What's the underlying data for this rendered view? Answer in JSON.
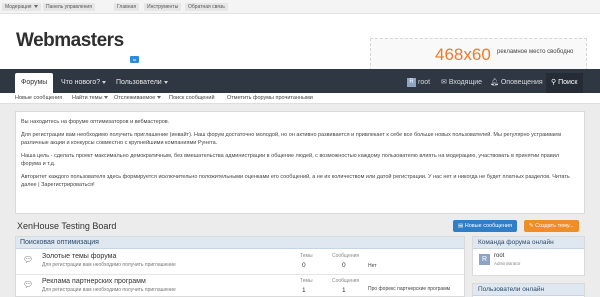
{
  "topbar": {
    "links": [
      {
        "label": "Модерация",
        "dropdown": true
      },
      {
        "label": "Панель управления"
      },
      {
        "label": "Главная"
      },
      {
        "label": "Инструменты"
      },
      {
        "label": "Обратная связь"
      }
    ]
  },
  "header": {
    "logo": "Webmasters",
    "logo_badge": "ru",
    "ad_size": "468x60",
    "ad_text": "рекламное место свободно"
  },
  "nav": {
    "tabs": [
      {
        "label": "Форумы"
      },
      {
        "label": "Что нового?"
      },
      {
        "label": "Пользователи"
      }
    ],
    "user": {
      "avatar_letter": "R",
      "name": "root"
    },
    "inbox": "Входящие",
    "alerts": "Оповещения",
    "search": "Поиск"
  },
  "subnav": {
    "links": [
      "Новые сообщения",
      "Найти темы",
      "Отслеживаемое",
      "Поиск сообщений",
      "Отметить форумы прочитанными"
    ]
  },
  "notice": {
    "p1": "Вы находитесь на форуме оптимизаторов и вебмастеров.",
    "p2": "Для регистрации вам необходимо получить приглашение (инвайт). Наш форум достаточно молодой, но он активно развивается и привлекает к себе все больше новых пользователей. Мы регулярно устраиваем различные акции и конкурсы совместно с крупнейшими компаниями Рунета.",
    "p3": "Наша цель - сделать проект максимально демократичным, без вмешательства администрации в общение людей, с возможностью каждому пользователю влиять на модерацию, участвовать в принятии правил форума и т.д.",
    "p4": "Авторитет каждого пользователя здесь формируется исключительно положительными оценками его сообщений, а не их количеством или датой регистрации. У нас нет и никогда не будет платных разделов. Читать далее | Зарегистрироваться!"
  },
  "board": {
    "title": "XenHouse Testing Board",
    "new_posts_button": "Новые сообщения",
    "create_thread_button": "Создать тему..."
  },
  "forum": {
    "category": "Поисковая оптимизация",
    "rows": [
      {
        "title": "Золотые темы форума",
        "desc": "Для регистрации вам необходимо получить приглашение",
        "threads_label": "Темы",
        "threads": "0",
        "posts_label": "Сообщения",
        "posts": "0",
        "last": "Нет"
      },
      {
        "title": "Реклама партнерских программ",
        "desc": "Для регистрации вам необходимо получить приглашение",
        "threads_label": "Темы",
        "threads": "1",
        "posts_label": "Сообщения",
        "posts": "1",
        "last": "Про форекс партнерские программ"
      }
    ]
  },
  "sidebar": {
    "staff_title": "Команда форума онлайн",
    "staff": [
      {
        "avatar_letter": "R",
        "name": "root",
        "role": "Administrator"
      }
    ],
    "online_title": "Пользователи онлайн"
  },
  "colors": {
    "nav_bg": "#2f3742",
    "accent_blue": "#2f7ec7",
    "accent_orange": "#ef8d27",
    "ad_orange": "#f07b22",
    "category_bg": "#dfe7f1"
  }
}
